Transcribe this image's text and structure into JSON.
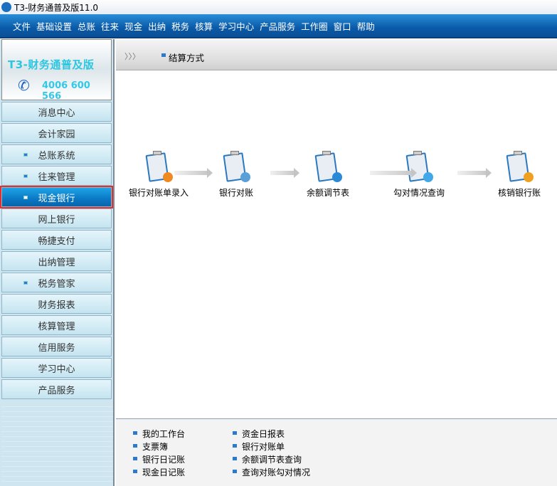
{
  "window": {
    "title": "T3-财务通普及版11.0"
  },
  "menu": [
    "文件",
    "基础设置",
    "总账",
    "往来",
    "现金",
    "出纳",
    "税务",
    "核算",
    "学习中心",
    "产品服务",
    "工作圈",
    "窗口",
    "帮助"
  ],
  "brand": {
    "name": "T3-财务通普及版",
    "phone": "4006 600 566"
  },
  "sidebar": [
    {
      "label": "消息中心",
      "bullet": false
    },
    {
      "label": "会计家园",
      "bullet": false
    },
    {
      "label": "总账系统",
      "bullet": true
    },
    {
      "label": "往来管理",
      "bullet": true
    },
    {
      "label": "现金银行",
      "bullet": true,
      "active": true
    },
    {
      "label": "网上银行",
      "bullet": false
    },
    {
      "label": "畅捷支付",
      "bullet": false
    },
    {
      "label": "出纳管理",
      "bullet": false
    },
    {
      "label": "税务管家",
      "bullet": true
    },
    {
      "label": "财务报表",
      "bullet": false
    },
    {
      "label": "核算管理",
      "bullet": false
    },
    {
      "label": "信用服务",
      "bullet": false
    },
    {
      "label": "学习中心",
      "bullet": false
    },
    {
      "label": "产品服务",
      "bullet": false
    }
  ],
  "tab": {
    "label": "结算方式"
  },
  "flow": [
    {
      "label": "银行对账单录入",
      "icon": "bank-statement-entry-icon",
      "accent": "#f08a20"
    },
    {
      "label": "银行对账",
      "icon": "bank-reconcile-icon",
      "accent": "#5aa0d8"
    },
    {
      "label": "余额调节表",
      "icon": "balance-adjust-icon",
      "accent": "#2a8ad8"
    },
    {
      "label": "勾对情况查询",
      "icon": "check-query-icon",
      "accent": "#40a8e8"
    },
    {
      "label": "核销银行账",
      "icon": "writeoff-bank-icon",
      "accent": "#f0a020"
    }
  ],
  "links": [
    [
      "我的工作台",
      "支票簿",
      "银行日记账",
      "现金日记账"
    ],
    [
      "资金日报表",
      "银行对账单",
      "余额调节表查询",
      "查询对账勾对情况"
    ]
  ]
}
